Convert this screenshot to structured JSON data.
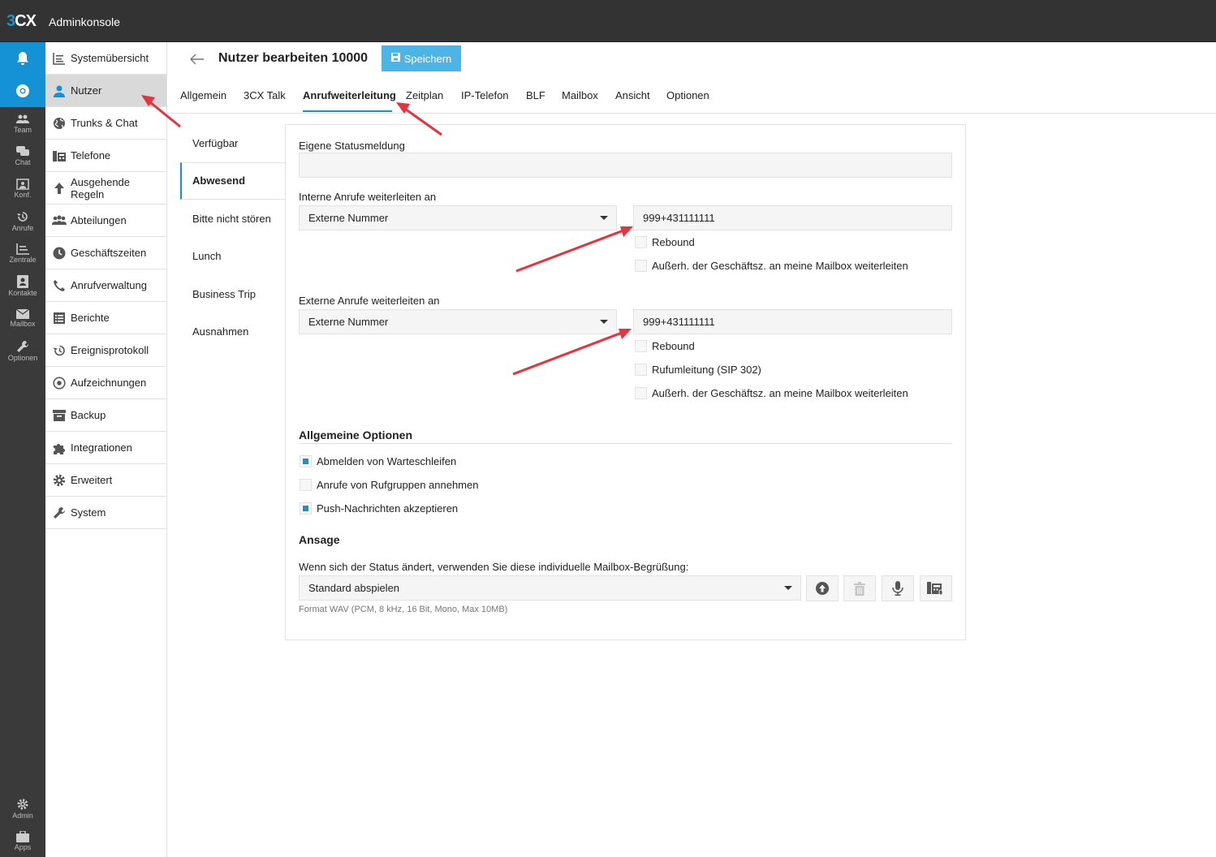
{
  "app": {
    "logo_3": "3",
    "logo_cx": "CX",
    "title": "Adminkonsole"
  },
  "rail": {
    "items": [
      {
        "label": "Team",
        "icon": "team-icon"
      },
      {
        "label": "Chat",
        "icon": "chat-icon"
      },
      {
        "label": "Konf.",
        "icon": "conference-icon"
      },
      {
        "label": "Anrufe",
        "icon": "history-icon"
      },
      {
        "label": "Zentrale",
        "icon": "switchboard-icon"
      },
      {
        "label": "Kontakte",
        "icon": "contacts-icon"
      },
      {
        "label": "Mailbox",
        "icon": "mail-icon"
      },
      {
        "label": "Optionen",
        "icon": "wrench-icon"
      }
    ],
    "bottom": [
      {
        "label": "Admin",
        "icon": "gear-icon"
      },
      {
        "label": "Apps",
        "icon": "apps-icon"
      }
    ]
  },
  "sidenav": {
    "items": [
      {
        "label": "Systemübersicht"
      },
      {
        "label": "Nutzer",
        "active": true
      },
      {
        "label": "Trunks & Chat"
      },
      {
        "label": "Telefone"
      },
      {
        "label": "Ausgehende Regeln"
      },
      {
        "label": "Abteilungen"
      },
      {
        "label": "Geschäftszeiten"
      },
      {
        "label": "Anrufverwaltung"
      },
      {
        "label": "Berichte"
      },
      {
        "label": "Ereignisprotokoll"
      },
      {
        "label": "Aufzeichnungen"
      },
      {
        "label": "Backup"
      },
      {
        "label": "Integrationen"
      },
      {
        "label": "Erweitert"
      },
      {
        "label": "System"
      }
    ]
  },
  "header": {
    "title": "Nutzer bearbeiten 10000",
    "save_label": "Speichern"
  },
  "tabs": [
    "Allgemein",
    "3CX Talk",
    "Anrufweiterleitung",
    "Zeitplan",
    "IP-Telefon",
    "BLF",
    "Mailbox",
    "Ansicht",
    "Optionen"
  ],
  "active_tab": "Anrufweiterleitung",
  "subnav": [
    "Verfügbar",
    "Abwesend",
    "Bitte nicht stören",
    "Lunch",
    "Business Trip",
    "Ausnahmen"
  ],
  "active_subnav": "Abwesend",
  "form": {
    "status_label": "Eigene Statusmeldung",
    "status_value": "",
    "internal": {
      "label": "Interne Anrufe weiterleiten an",
      "select_value": "Externe Nummer",
      "number": "999+431111111",
      "rebound": "Rebound",
      "mailbox_outside_hours": "Außerh. der Geschäftsz. an meine Mailbox weiterleiten"
    },
    "external": {
      "label": "Externe Anrufe weiterleiten an",
      "select_value": "Externe Nummer",
      "number": "999+431111111",
      "rebound": "Rebound",
      "sip302": "Rufumleitung (SIP 302)",
      "mailbox_outside_hours": "Außerh. der Geschäftsz. an meine Mailbox weiterleiten"
    },
    "general_title": "Allgemeine Optionen",
    "general_options": [
      {
        "label": "Abmelden von Warteschleifen",
        "checked": true
      },
      {
        "label": "Anrufe von Rufgruppen annehmen",
        "checked": false
      },
      {
        "label": "Push-Nachrichten akzeptieren",
        "checked": true
      }
    ],
    "announcement_title": "Ansage",
    "announcement_label": "Wenn sich der Status ändert, verwenden Sie diese individuelle Mailbox-Begrüßung:",
    "announcement_select": "Standard abspielen",
    "format_hint": "Format WAV (PCM, 8 kHz, 16 Bit, Mono, Max 10MB)"
  },
  "colors": {
    "accent": "#1591d6",
    "save_button": "#4cb4e6",
    "annotation_arrow": "#e8323c",
    "topbar": "#333333"
  }
}
